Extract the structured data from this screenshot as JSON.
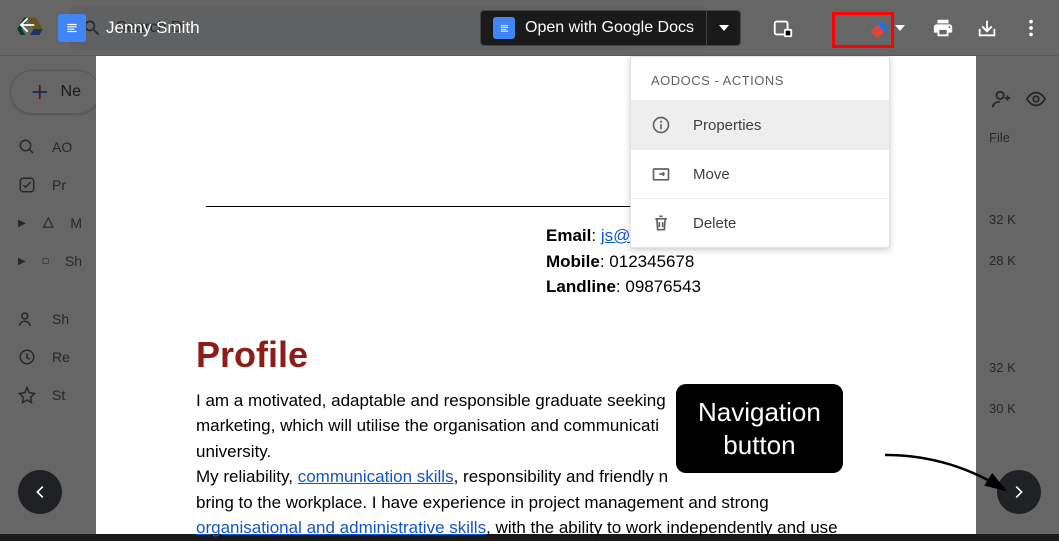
{
  "drive": {
    "search_placeholder": "Search D",
    "new_label": "Ne",
    "side": [
      "AO",
      "Pr",
      "M",
      "Sh",
      "Sh",
      "Re",
      "St"
    ],
    "file_header": "File",
    "sizes": [
      "32 K",
      "28 K",
      "32 K",
      "30 K"
    ]
  },
  "preview": {
    "title": "Jenny Smith",
    "open_with": "Open with Google Docs"
  },
  "aodocs_menu": {
    "header": "AODOCS - ACTIONS",
    "items": [
      {
        "label": "Properties"
      },
      {
        "label": "Move"
      },
      {
        "label": "Delete"
      }
    ]
  },
  "document": {
    "email_label": "Email",
    "email_value": "js@yaho.com",
    "mobile_label": "Mobile",
    "mobile_value": "012345678",
    "landline_label": "Landline",
    "landline_value": "09876543",
    "profile_heading": "Profile",
    "p1a": "I am a motivated, adaptable and responsible graduate seeking",
    "p1b": "marketing, which will utilise the organisation and communicati",
    "p1c": "university.",
    "p2a": "My reliability, ",
    "link1": "communication skills",
    "p2b": ", responsibility and friendly n",
    "p2c": "bring to the workplace. I have experience in project management and strong ",
    "link2": "organisational and administrative skills",
    "p2d": ", with the ability to work independently and use"
  },
  "annotation": {
    "line1": "Navigation",
    "line2": "button"
  }
}
